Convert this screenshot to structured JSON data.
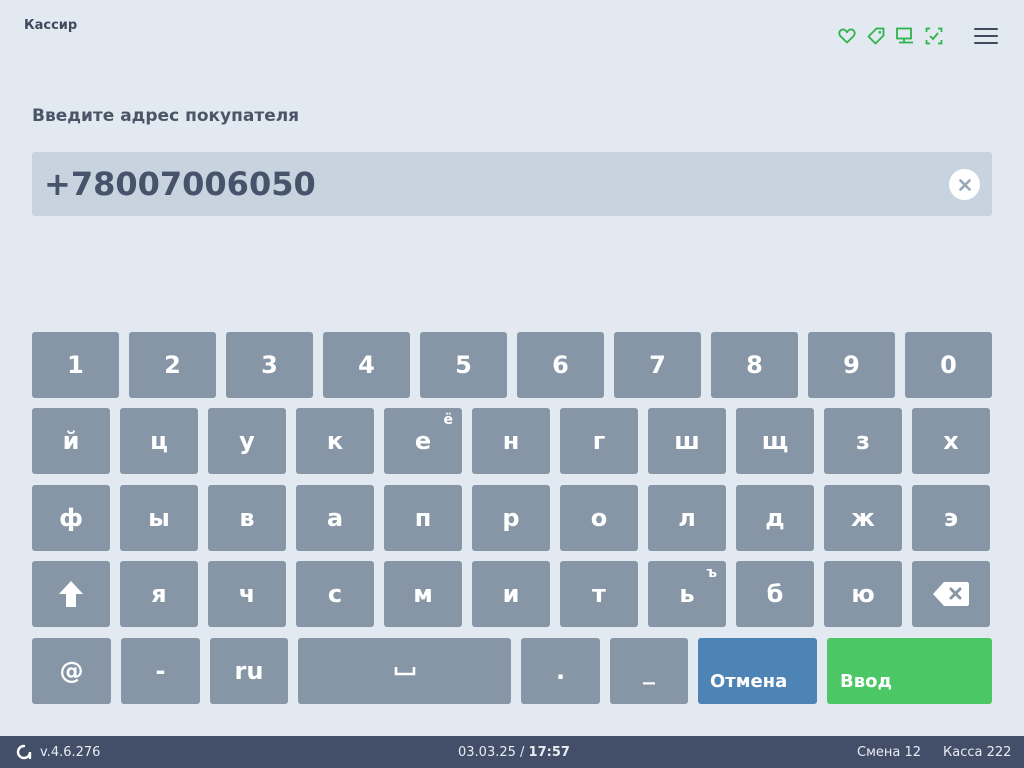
{
  "header": {
    "title": "Кассир",
    "icons": [
      "heart-icon",
      "tag-icon",
      "monitor-icon",
      "scan-check-icon"
    ],
    "accent_color": "#2fb34a"
  },
  "prompt": "Введите адрес покупателя",
  "input": {
    "value": "+78007006050"
  },
  "keyboard": {
    "digits": [
      "1",
      "2",
      "3",
      "4",
      "5",
      "6",
      "7",
      "8",
      "9",
      "0"
    ],
    "row1": [
      {
        "label": "й"
      },
      {
        "label": "ц"
      },
      {
        "label": "у"
      },
      {
        "label": "к"
      },
      {
        "label": "е",
        "alt": "ё"
      },
      {
        "label": "н"
      },
      {
        "label": "г"
      },
      {
        "label": "ш"
      },
      {
        "label": "щ"
      },
      {
        "label": "з"
      },
      {
        "label": "х"
      }
    ],
    "row2": [
      "ф",
      "ы",
      "в",
      "а",
      "п",
      "р",
      "о",
      "л",
      "д",
      "ж",
      "э"
    ],
    "row3": [
      {
        "label": ""
      },
      {
        "label": "я"
      },
      {
        "label": "ч"
      },
      {
        "label": "с"
      },
      {
        "label": "м"
      },
      {
        "label": "и"
      },
      {
        "label": "т"
      },
      {
        "label": "ь",
        "alt": "ъ"
      },
      {
        "label": "б"
      },
      {
        "label": "ю"
      },
      {
        "label": ""
      }
    ],
    "bottom": {
      "at": "@",
      "dash": "-",
      "lang": "ru",
      "space": "␣",
      "dot": ".",
      "underscore": "_",
      "cancel": "Отмена",
      "enter": "Ввод"
    },
    "key_color": "#8796a6",
    "cancel_color": "#4e83b6",
    "enter_color": "#4bc865"
  },
  "footer": {
    "version": "v.4.6.276",
    "date": "03.03.25",
    "separator": " / ",
    "time": "17:57",
    "shift": "Смена 12",
    "register": "Касса 222"
  }
}
